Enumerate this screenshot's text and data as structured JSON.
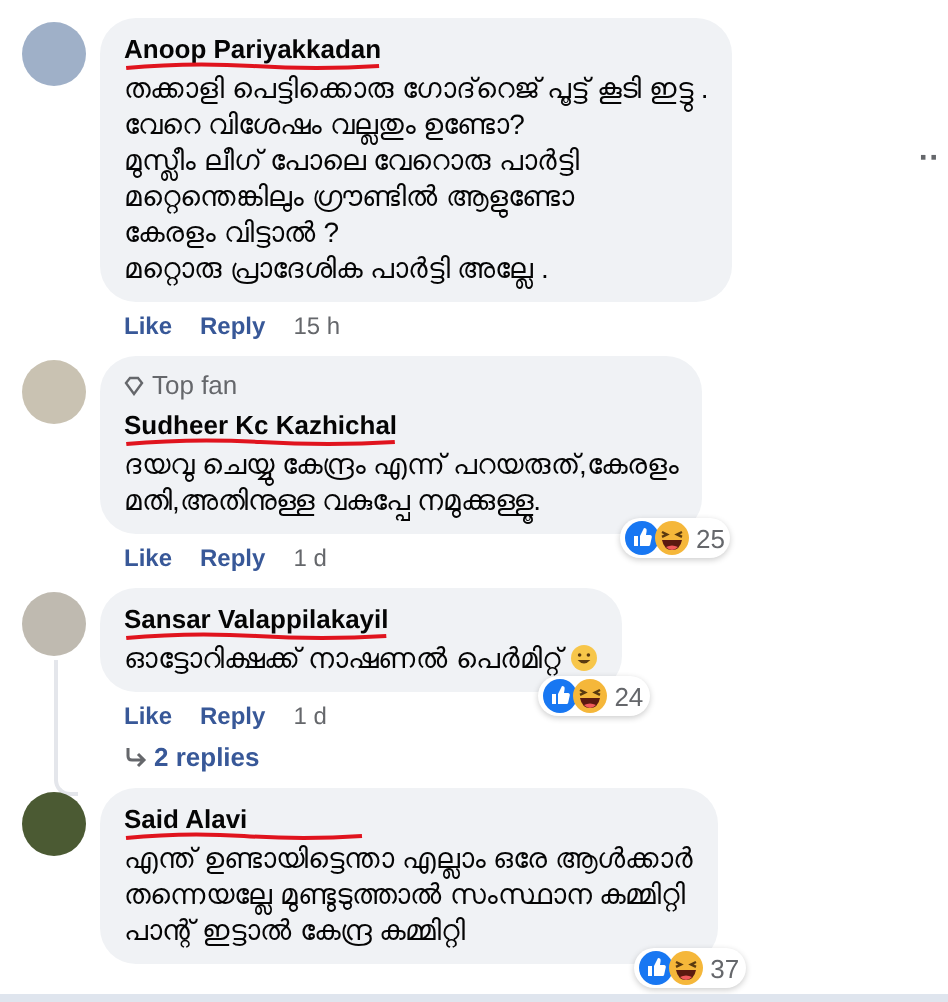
{
  "comments": [
    {
      "author": "Anoop Pariyakkadan",
      "struck": true,
      "lines": [
        "തക്കാളി പെട്ടിക്കൊരു ഗോദ്‌റെജ് പൂട്ട് കൂടി ഇട്ടു .",
        "വേറെ വിശേഷം വല്ലതും ഉണ്ടോ?",
        "മുസ്ലീം ലീഗ് പോലെ വേറൊരു പാർട്ടി",
        "മറ്റെന്തെങ്കിലും ഗ്രൗണ്ടിൽ ആളുണ്ടോ",
        "കേരളം വിട്ടാൽ ?",
        "മറ്റൊരു പ്രാദേശിക പാർട്ടി അല്ലേ ."
      ],
      "more": "··",
      "actions": [
        "Like",
        "Reply"
      ],
      "time": "15 h"
    },
    {
      "author": "Sudheer Kc Kazhichal",
      "struck": true,
      "badge": "Top fan",
      "lines": [
        "ദയവു ചെയ്യു കേന്ദ്രം എന്ന് പറയരുത്,കേരളം",
        "മതി,അതിനുള്ള വകുപ്പേ നമുക്കുള്ളൂ."
      ],
      "reactions": "25",
      "actions": [
        "Like",
        "Reply"
      ],
      "time": "1 d"
    },
    {
      "author": "Sansar Valappilakayil",
      "struck": true,
      "lines": [
        "ഓട്ടോറിക്ഷക്ക് നാഷണൽ പെർമിറ്റ്"
      ],
      "emoji": true,
      "reactions": "24",
      "actions": [
        "Like",
        "Reply"
      ],
      "time": "1 d",
      "replies": "2 replies"
    },
    {
      "author": "Said Alavi",
      "struck": true,
      "lines": [
        "എന്ത് ഉണ്ടായിട്ടെന്താ എല്ലാം ഒരേ ആൾക്കാർ",
        "തന്നെയല്ലേ മുണ്ടുടുത്താൽ സംസ്ഥാന കമ്മിറ്റി",
        "പാന്റ് ഇട്ടാൽ കേന്ദ്ര കമ്മിറ്റി"
      ],
      "reactions": "37"
    }
  ]
}
